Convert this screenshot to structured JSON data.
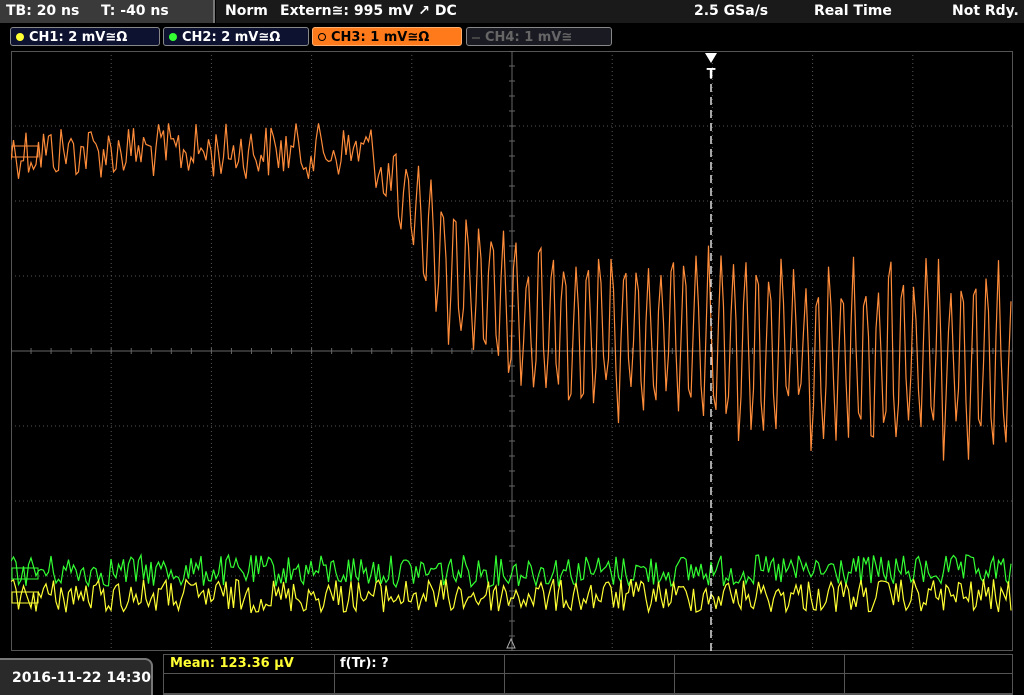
{
  "topbar": {
    "timebase": "TB: 20 ns",
    "trigger_time": "T: -40 ns",
    "trigger_mode": "Norm",
    "trigger_source": "Extern≅: 995 mV ↗ DC",
    "sample_rate": "2.5 GSa/s",
    "acq_mode": "Real Time",
    "status": "Not Rdy."
  },
  "channels": [
    {
      "label": "CH1: 2 mV≅Ω",
      "color": "#ffff33"
    },
    {
      "label": "CH2: 2 mV≅Ω",
      "color": "#33ff33"
    },
    {
      "label": "CH3: 1 mV≅Ω",
      "color": "#ff7a1a"
    },
    {
      "label": "CH4: 1 mV≅",
      "color": "#555555"
    }
  ],
  "trigger_marker": "T",
  "measurements": {
    "mean": "Mean: 123.36 µV",
    "ftr": "f(Tr): ?"
  },
  "datetime": "2016-11-22 14:30",
  "colors": {
    "ch1": "#ffff33",
    "ch2": "#33ff33",
    "ch3": "#ff8c3a",
    "grid": "#555555"
  }
}
